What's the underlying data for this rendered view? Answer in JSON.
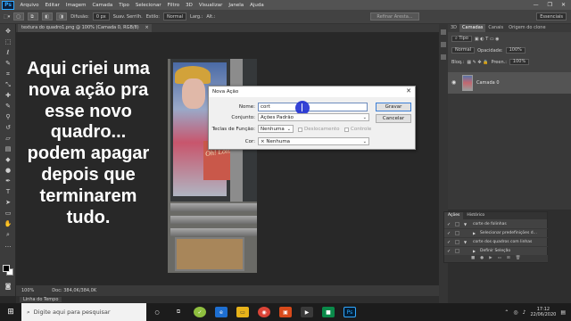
{
  "app": {
    "logo": "Ps",
    "menu": [
      "Arquivo",
      "Editar",
      "Imagem",
      "Camada",
      "Tipo",
      "Selecionar",
      "Filtro",
      "3D",
      "Visualizar",
      "Janela",
      "Ajuda"
    ],
    "window_controls": [
      "—",
      "❐",
      "✕"
    ]
  },
  "options_bar": {
    "difusao_label": "Difusão:",
    "difusao_value": "0 px",
    "suav_label": "Suav. Serrilh.",
    "estilo_label": "Estilo:",
    "estilo_value": "Normal",
    "larg_label": "Larg.:",
    "alt_label": "Alt.:",
    "refine_label": "Refinar Aresta...",
    "workspace_value": "Essenciais"
  },
  "document": {
    "tab_title": "textura do quadro1.png @ 100% (Camada 0, RGB/8)",
    "sign_text": "Oh! Loib",
    "caption": "Aqui criei uma nova ação pra esse novo quadro... podem apagar depois que terminarem tudo.",
    "zoom": "100%",
    "doc_info": "Doc: 384,0K/384,0K"
  },
  "timeline": {
    "label": "Linha do Tempo"
  },
  "dialog": {
    "title": "Nova Ação",
    "nome_label": "Nome:",
    "nome_value": "cort",
    "conjunto_label": "Conjunto:",
    "conjunto_value": "Ações Padrão",
    "teclas_label": "Teclas de Função:",
    "teclas_value": "Nenhuma",
    "deslocamento_label": "Deslocamento",
    "controle_label": "Controle",
    "cor_label": "Cor:",
    "cor_value": "Nenhuma",
    "gravar_label": "Gravar",
    "cancelar_label": "Cancelar"
  },
  "panels": {
    "top_tabs": [
      "3D",
      "Camadas",
      "Canais",
      "Origem do clone"
    ],
    "active_tab": "Camadas",
    "tipo_label": "Tipo",
    "normal_value": "Normal",
    "opacidade_label": "Opacidade:",
    "opacidade_value": "100%",
    "bloq_label": "Bloq.:",
    "preench_label": "Preen.:",
    "preench_value": "100%",
    "layer_name": "Camada 0"
  },
  "actions_panel": {
    "tabs": [
      "Ações",
      "Histórico"
    ],
    "rows": [
      {
        "label": "corte de folinhas",
        "indent": 16
      },
      {
        "label": "Selecionar predefinições d...",
        "indent": 30
      },
      {
        "label": "corte dos quadros com linhas",
        "indent": 16
      },
      {
        "label": "Definir Seleção",
        "indent": 30
      }
    ]
  },
  "taskbar": {
    "search_placeholder": "Digite aqui para pesquisar",
    "time": "17:12",
    "date": "22/06/2020"
  }
}
